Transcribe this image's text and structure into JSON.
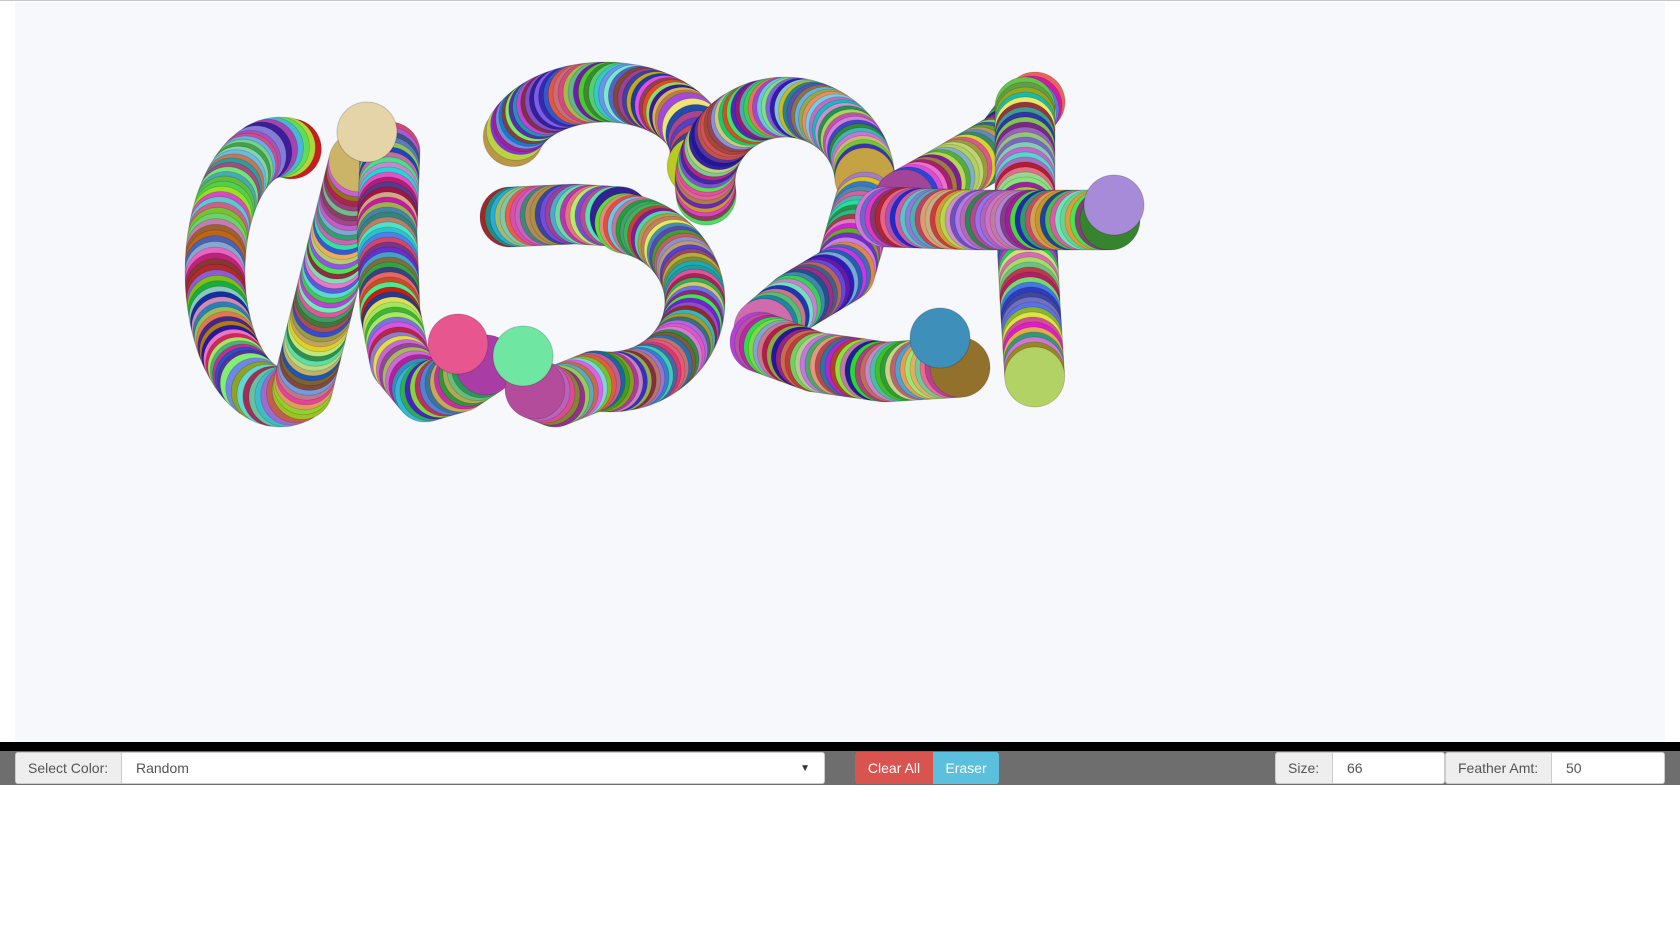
{
  "canvas": {
    "background": "#f6f8fc",
    "drawing_text": "a324"
  },
  "toolbar": {
    "color_label": "Select Color:",
    "color_value": "Random",
    "clear_label": "Clear All",
    "eraser_label": "Eraser",
    "size_label": "Size:",
    "size_value": "66",
    "feather_label": "Feather Amt:",
    "feather_value": "50"
  },
  "colors": {
    "toolbar_bg": "#6e6e6e",
    "clear": "#d9534f",
    "eraser": "#5bc0de"
  }
}
